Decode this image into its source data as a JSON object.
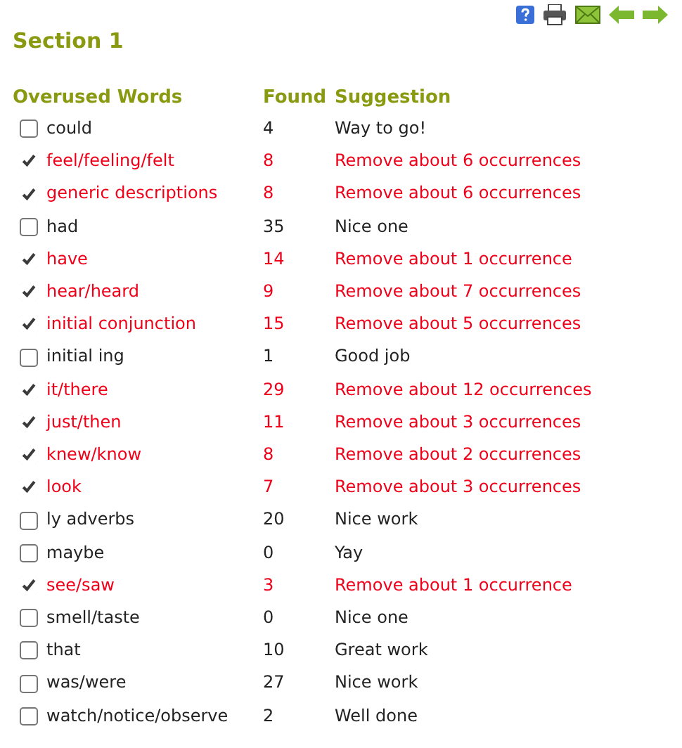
{
  "section_title": "Section 1",
  "columns": [
    "Overused Words",
    "Found",
    "Suggestion"
  ],
  "rows": [
    {
      "word": "could",
      "found": "4",
      "suggestion": "Way to go!",
      "checked": false
    },
    {
      "word": "feel/feeling/felt",
      "found": "8",
      "suggestion": "Remove about 6 occurrences",
      "checked": true
    },
    {
      "word": "generic descriptions",
      "found": "8",
      "suggestion": "Remove about 6 occurrences",
      "checked": true
    },
    {
      "word": "had",
      "found": "35",
      "suggestion": "Nice one",
      "checked": false
    },
    {
      "word": "have",
      "found": "14",
      "suggestion": "Remove about 1 occurrence",
      "checked": true
    },
    {
      "word": "hear/heard",
      "found": "9",
      "suggestion": "Remove about 7 occurrences",
      "checked": true
    },
    {
      "word": "initial conjunction",
      "found": "15",
      "suggestion": "Remove about 5 occurrences",
      "checked": true
    },
    {
      "word": "initial ing",
      "found": "1",
      "suggestion": "Good job",
      "checked": false
    },
    {
      "word": "it/there",
      "found": "29",
      "suggestion": "Remove about 12 occurrences",
      "checked": true
    },
    {
      "word": "just/then",
      "found": "11",
      "suggestion": "Remove about 3 occurrences",
      "checked": true
    },
    {
      "word": "knew/know",
      "found": "8",
      "suggestion": "Remove about 2 occurrences",
      "checked": true
    },
    {
      "word": "look",
      "found": "7",
      "suggestion": "Remove about 3 occurrences",
      "checked": true
    },
    {
      "word": "ly adverbs",
      "found": "20",
      "suggestion": "Nice work",
      "checked": false
    },
    {
      "word": "maybe",
      "found": "0",
      "suggestion": "Yay",
      "checked": false
    },
    {
      "word": "see/saw",
      "found": "3",
      "suggestion": "Remove about 1 occurrence",
      "checked": true
    },
    {
      "word": "smell/taste",
      "found": "0",
      "suggestion": "Nice one",
      "checked": false
    },
    {
      "word": "that",
      "found": "10",
      "suggestion": "Great work",
      "checked": false
    },
    {
      "word": "was/were",
      "found": "27",
      "suggestion": "Nice work",
      "checked": false
    },
    {
      "word": "watch/notice/observe",
      "found": "2",
      "suggestion": "Well done",
      "checked": false
    }
  ]
}
